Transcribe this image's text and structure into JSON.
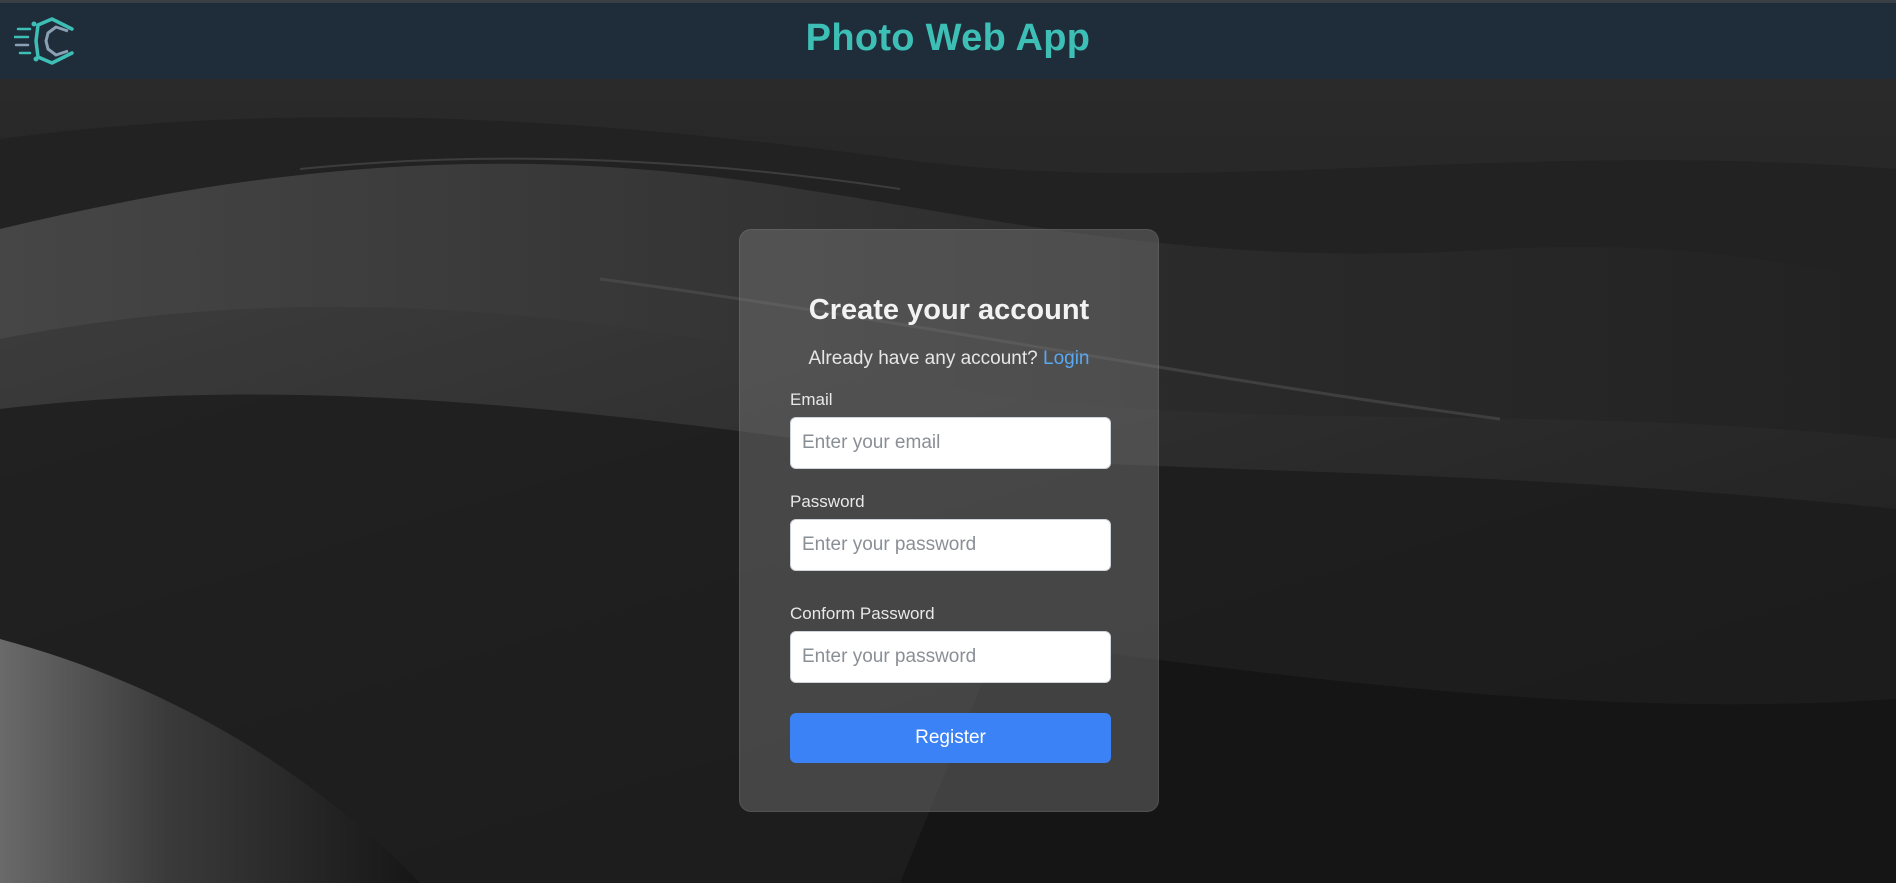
{
  "header": {
    "title": "Photo Web App",
    "logo_icon": "code-c-logo-icon",
    "title_color": "#3dbfb6",
    "background_color": "#1f2c3a"
  },
  "form": {
    "title": "Create your account",
    "subtitle": "Already have any account?",
    "login_link": "Login",
    "email": {
      "label": "Email",
      "placeholder": "Enter your email",
      "value": ""
    },
    "password": {
      "label": "Password",
      "placeholder": "Enter your password",
      "value": ""
    },
    "confirm_password": {
      "label": "Conform Password",
      "placeholder": "Enter your password",
      "value": ""
    },
    "register_label": "Register",
    "register_color": "#3b82f6",
    "link_color": "#5aa8f0"
  }
}
